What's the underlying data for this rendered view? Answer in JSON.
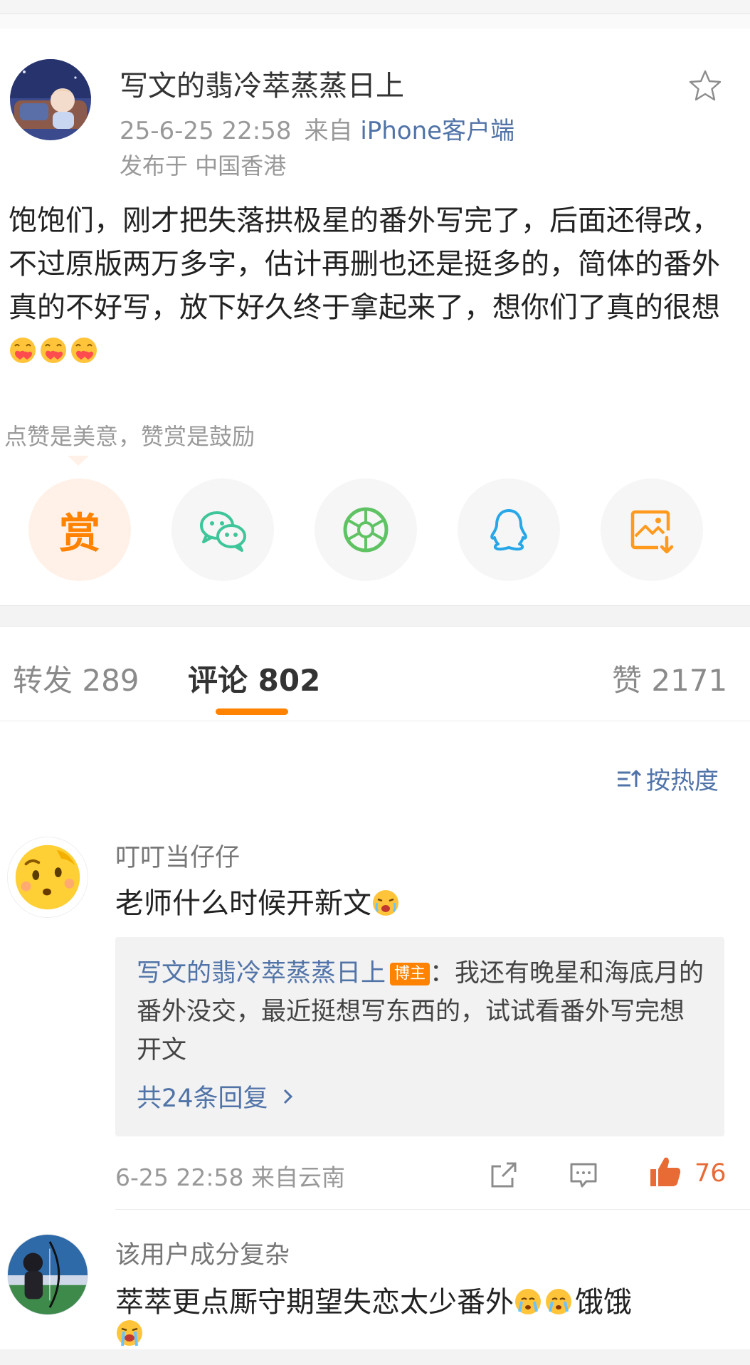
{
  "post": {
    "author": "写文的翡冷萃蒸蒸日上",
    "time": "25-6-25 22:58",
    "source_prefix": "来自",
    "source": "iPhone客户端",
    "location": "发布于 中国香港",
    "body": "饱饱们，刚才把失落拱极星的番外写完了，后面还得改，不过原版两万多字，估计再删也还是挺多的，简体的番外真的不好写，放下好久终于拿起来了，想你们了真的很想",
    "body_emojis": [
      "heart-face-emoji",
      "heart-face-emoji",
      "heart-face-emoji"
    ],
    "favorite_icon": "star-icon"
  },
  "reward": {
    "hint": "点赞是美意，赞赏是鼓励",
    "reward_label": "赏",
    "share_targets": [
      "wechat-icon",
      "moments-icon",
      "qq-icon",
      "save-image-icon"
    ]
  },
  "tabs": [
    {
      "label": "转发 289"
    },
    {
      "label": "评论 802"
    },
    {
      "label": "赞 2171"
    }
  ],
  "sort_label": "按热度",
  "comments": [
    {
      "name": "叮叮当仔仔",
      "text": "老师什么时候开新文",
      "reply": {
        "author": "写文的翡冷萃蒸蒸日上",
        "badge": "博主",
        "text": "：我还有晚星和海底月的番外没交，最近挺想写东西的，试试看番外写完想开文",
        "more": "共24条回复"
      },
      "time": "6-25 22:58",
      "source": "来自云南",
      "likes": "76"
    },
    {
      "name": "该用户成分复杂",
      "text_line1": "萃萃更点厮守期望失恋太少番外",
      "text_line1_tail": "饿饿"
    }
  ],
  "colors": {
    "accent": "#ff8200",
    "link": "#5073a8",
    "like": "#e86b36",
    "wechat": "#3ec69a",
    "moments": "#5fc364",
    "qq": "#27a7e8"
  }
}
